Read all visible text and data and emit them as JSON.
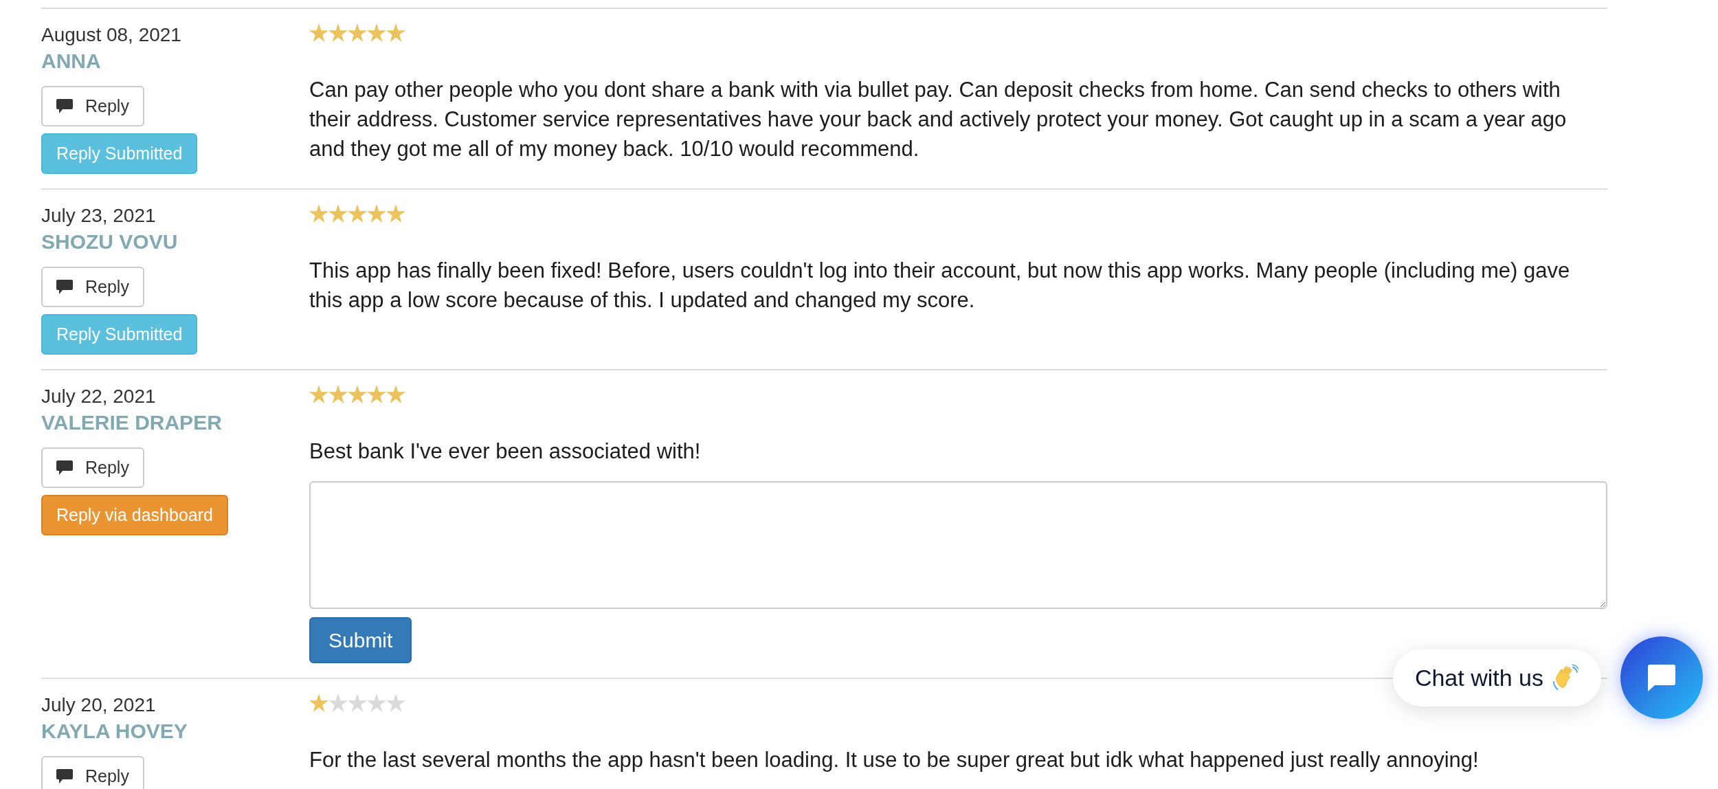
{
  "reviews": [
    {
      "date": "August 08, 2021",
      "author": "ANNA",
      "stars": 5,
      "reply_button": "Reply",
      "status_button": {
        "kind": "submitted",
        "label": "Reply Submitted"
      },
      "text": "Can pay other people who you dont share a bank with via bullet pay. Can deposit checks from home. Can send checks to others with their address. Customer service representatives have your back and actively protect your money. Got caught up in a scam a year ago and they got me all of my money back. 10/10 would recommend."
    },
    {
      "date": "July 23, 2021",
      "author": "SHOZU VOVU",
      "stars": 5,
      "reply_button": "Reply",
      "status_button": {
        "kind": "submitted",
        "label": "Reply Submitted"
      },
      "text": "This app has finally been fixed! Before, users couldn't log into their account, but now this app works. Many people (including me) gave this app a low score because of this. I updated and changed my score."
    },
    {
      "date": "July 22, 2021",
      "author": "VALERIE DRAPER",
      "stars": 5,
      "reply_button": "Reply",
      "status_button": {
        "kind": "dashboard",
        "label": "Reply via dashboard"
      },
      "text": "Best bank I've ever been associated with!",
      "reply_form": {
        "submit": "Submit"
      }
    },
    {
      "date": "July 20, 2021",
      "author": "KAYLA HOVEY",
      "stars": 1,
      "reply_button": "Reply",
      "text": "For the last several months the app hasn't been loading. It use to be super great but idk what happened just really annoying!"
    }
  ],
  "chat_widget": {
    "label": "Chat with us"
  }
}
